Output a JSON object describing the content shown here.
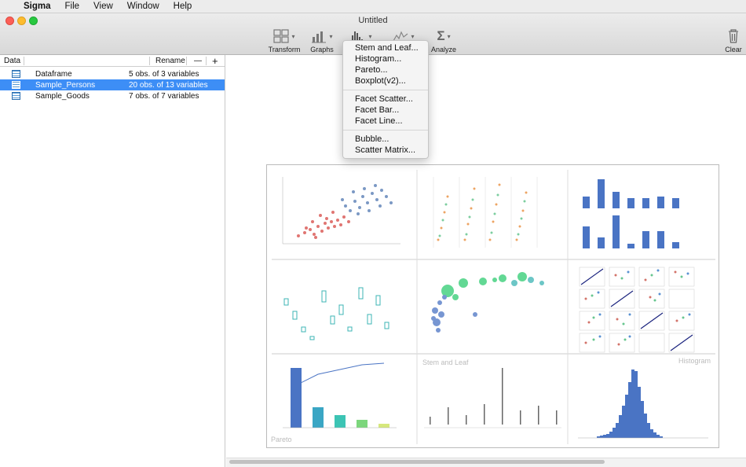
{
  "menubar": {
    "app": "Sigma",
    "items": [
      "File",
      "View",
      "Window",
      "Help"
    ]
  },
  "window": {
    "title": "Untitled"
  },
  "toolbar": {
    "transform": "Transform",
    "graphs": "Graphs",
    "analyze": "Analyze",
    "clear": "Clear"
  },
  "sidebar": {
    "header": {
      "data_label": "Data",
      "rename": "Rename",
      "remove": "—",
      "add": "+"
    },
    "rows": [
      {
        "name": "Dataframe",
        "desc": "5 obs. of 3 variables"
      },
      {
        "name": "Sample_Persons",
        "desc": "20 obs. of 13 variables"
      },
      {
        "name": "Sample_Goods",
        "desc": "7 obs. of 7 variables"
      }
    ]
  },
  "menu": {
    "group1": [
      "Stem and Leaf...",
      "Histogram...",
      "Pareto...",
      "Boxplot(v2)..."
    ],
    "group2": [
      "Facet Scatter...",
      "Facet Bar...",
      "Facet Line..."
    ],
    "group3": [
      "Bubble...",
      "Scatter Matrix..."
    ]
  },
  "gallery": {
    "pareto_label": "Pareto",
    "stem_label": "Stem and Leaf",
    "hist_label": "Histogram"
  },
  "colors": {
    "accent": "#3d8ef6",
    "bar": "#4a74c4",
    "red": "#d9534f",
    "green": "#2ecc71"
  }
}
